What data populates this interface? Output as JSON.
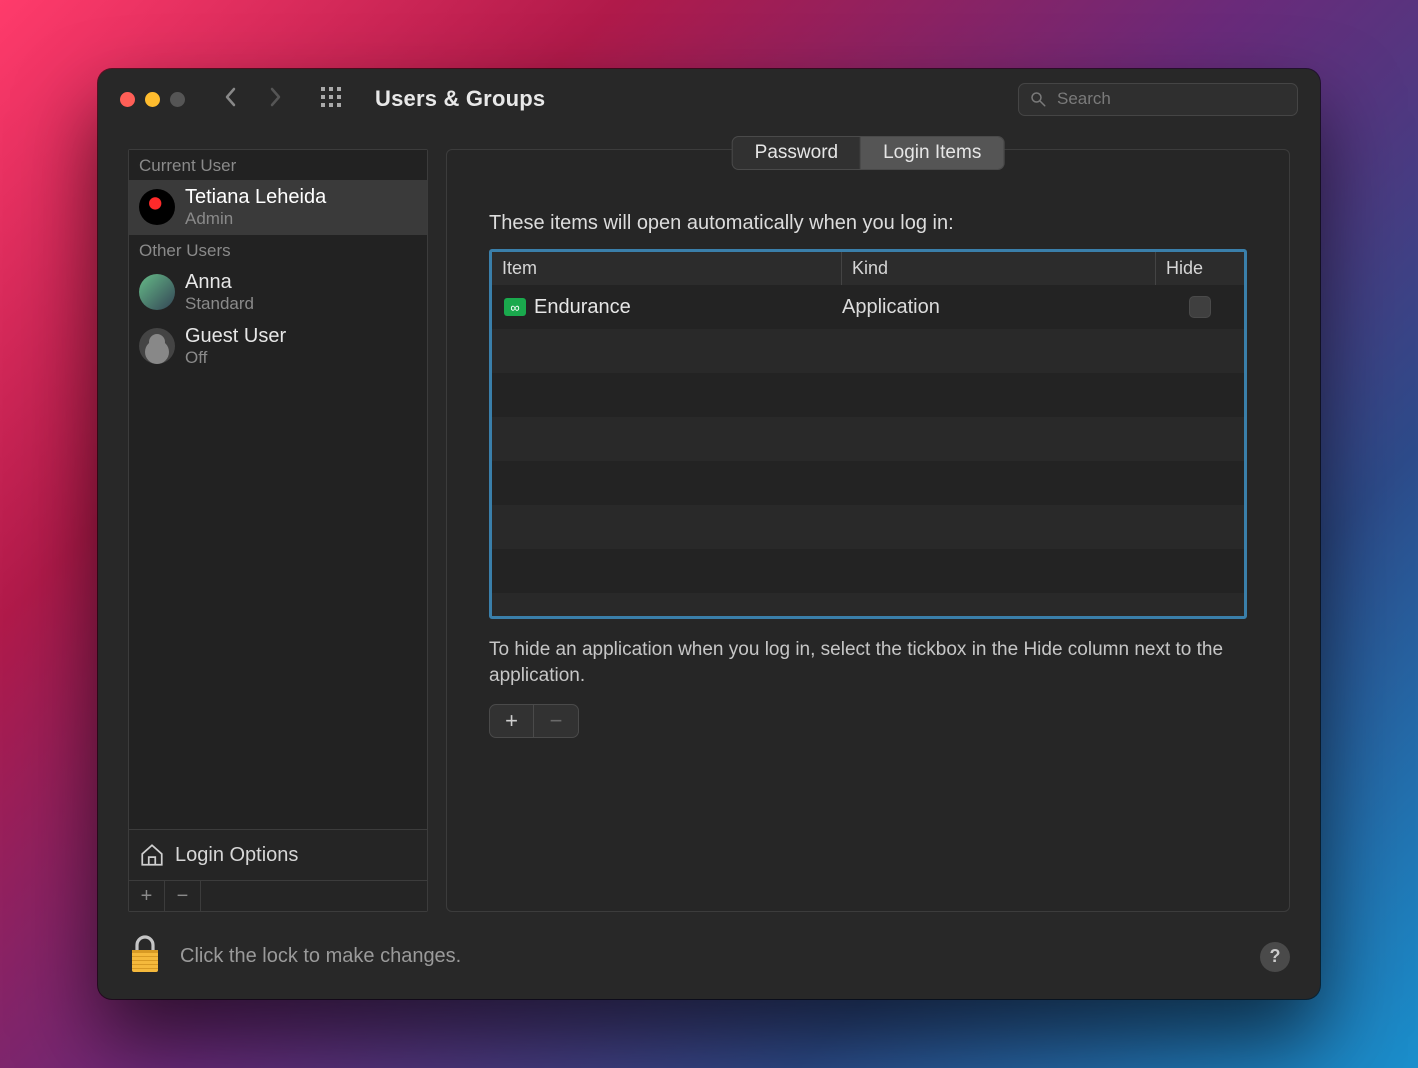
{
  "window": {
    "title": "Users & Groups"
  },
  "search": {
    "placeholder": "Search"
  },
  "sidebar": {
    "sections": [
      {
        "label": "Current User"
      },
      {
        "label": "Other Users"
      }
    ],
    "current_user": {
      "name": "Tetiana Leheida",
      "role": "Admin"
    },
    "other_users": [
      {
        "name": "Anna",
        "role": "Standard"
      },
      {
        "name": "Guest User",
        "role": "Off"
      }
    ],
    "login_options": "Login Options"
  },
  "tabs": {
    "password": "Password",
    "login_items": "Login Items",
    "active": "login_items"
  },
  "panel": {
    "heading": "These items will open automatically when you log in:",
    "columns": {
      "item": "Item",
      "kind": "Kind",
      "hide": "Hide"
    },
    "rows": [
      {
        "icon": "infinity",
        "name": "Endurance",
        "kind": "Application",
        "hide": false
      }
    ],
    "note": "To hide an application when you log in, select the tickbox in the Hide column next to the application."
  },
  "footer": {
    "lock_text": "Click the lock to make changes."
  },
  "icons": {
    "grid": "apps-grid-icon",
    "lock": "lock-icon",
    "help": "?"
  },
  "colors": {
    "accent": "#3a7faa"
  }
}
